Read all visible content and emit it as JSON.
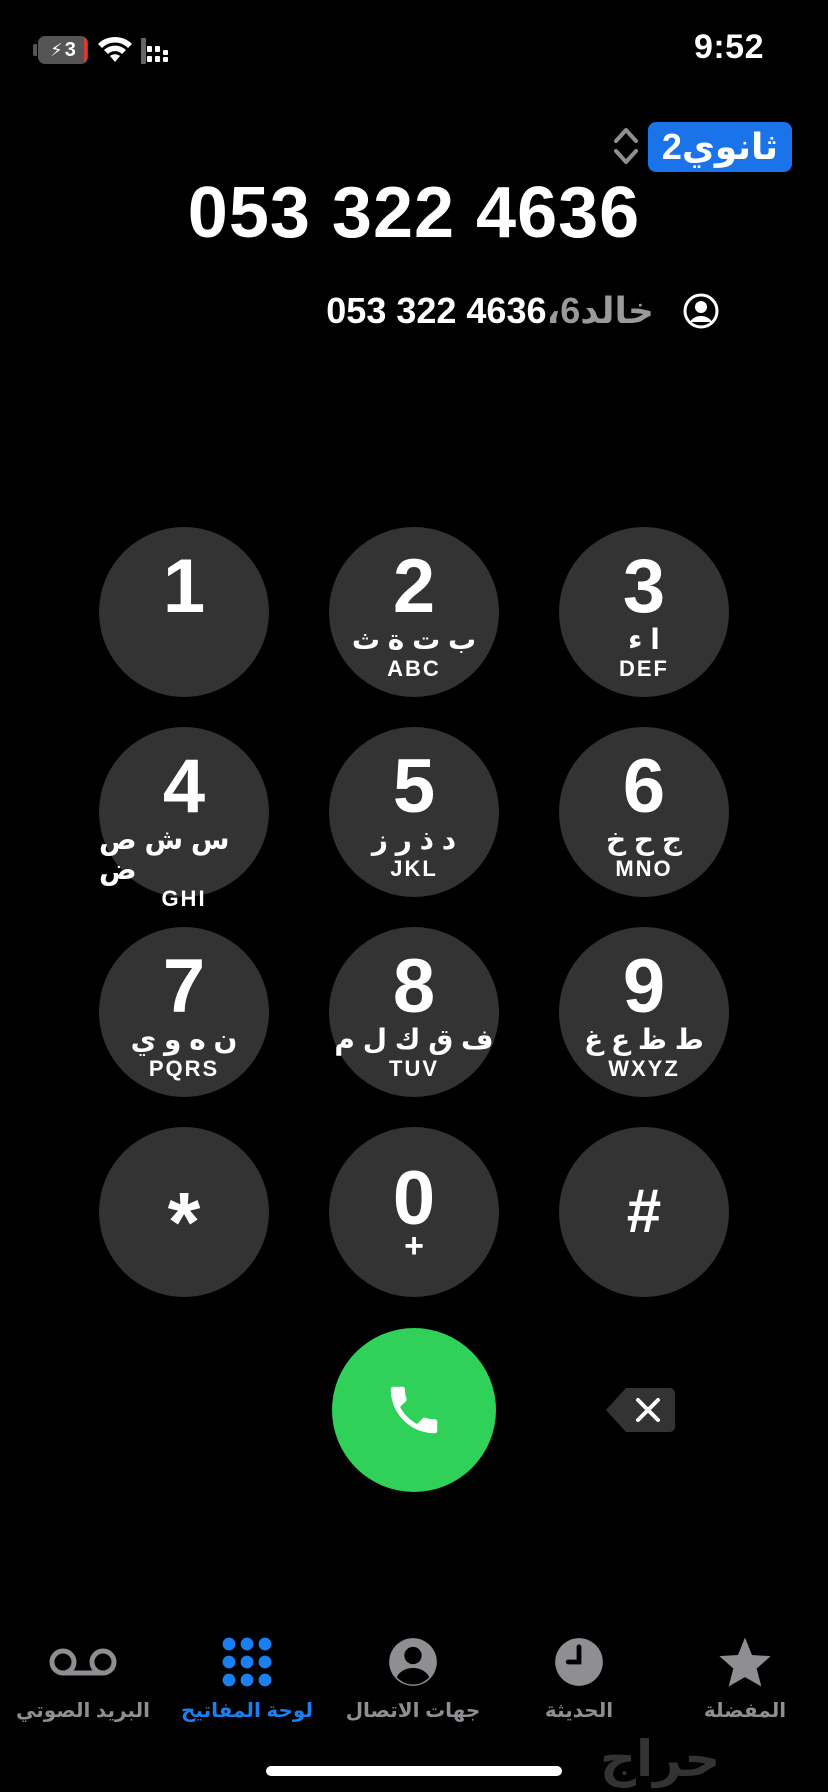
{
  "status_bar": {
    "time": "9:52",
    "battery_level": "3",
    "icons": [
      "battery-charging-icon",
      "wifi-icon",
      "cellular-signal-icon"
    ]
  },
  "dialer": {
    "line_label": "ثانوي2",
    "entered_number": "053 322 4636",
    "suggestion": {
      "name": "خالد6",
      "separator": "،",
      "number": "053 322 4636"
    }
  },
  "keypad": [
    {
      "digit": "1",
      "arabic": "",
      "letters": ""
    },
    {
      "digit": "2",
      "arabic": "ب ت ة ث",
      "letters": "ABC"
    },
    {
      "digit": "3",
      "arabic": "ا ء",
      "letters": "DEF"
    },
    {
      "digit": "4",
      "arabic": "س ش ص ض",
      "letters": "GHI"
    },
    {
      "digit": "5",
      "arabic": "د ذ ر ز",
      "letters": "JKL"
    },
    {
      "digit": "6",
      "arabic": "ج ح خ",
      "letters": "MNO"
    },
    {
      "digit": "7",
      "arabic": "ن ه و ي",
      "letters": "PQRS"
    },
    {
      "digit": "8",
      "arabic": "ف ق ك ل م",
      "letters": "TUV"
    },
    {
      "digit": "9",
      "arabic": "ط ظ ع غ",
      "letters": "WXYZ"
    },
    {
      "digit": "*",
      "arabic": "",
      "letters": ""
    },
    {
      "digit": "0",
      "arabic": "",
      "letters": "+"
    },
    {
      "digit": "#",
      "arabic": "",
      "letters": ""
    }
  ],
  "tabs": [
    {
      "label": "المفضلة",
      "icon": "star-icon",
      "active": false
    },
    {
      "label": "الحديثة",
      "icon": "clock-icon",
      "active": false
    },
    {
      "label": "جهات الاتصال",
      "icon": "contacts-icon",
      "active": false
    },
    {
      "label": "لوحة المفاتيح",
      "icon": "keypad-icon",
      "active": true
    },
    {
      "label": "البريد الصوتي",
      "icon": "voicemail-icon",
      "active": false
    }
  ],
  "watermark": "حراج",
  "colors": {
    "background": "#000000",
    "key_background": "#333333",
    "call_green": "#30d158",
    "accent_blue": "#1a7ff0",
    "tab_inactive": "#8e8e93",
    "line_badge_blue": "#1a73e8"
  }
}
